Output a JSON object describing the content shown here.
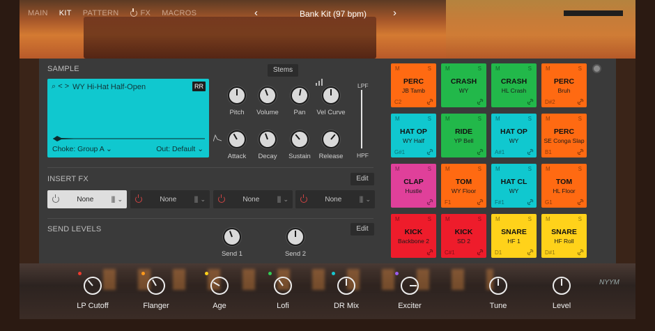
{
  "nav": {
    "items": [
      {
        "label": "MAIN",
        "active": false
      },
      {
        "label": "KIT",
        "active": true
      },
      {
        "label": "PATTERN",
        "active": false
      },
      {
        "label": "FX",
        "active": false
      },
      {
        "label": "MACROS",
        "active": false
      }
    ],
    "prev_icon": "‹",
    "next_icon": "›",
    "preset": "Bank Kit (97 bpm)"
  },
  "sample": {
    "section_label": "SAMPLE",
    "stems_label": "Stems",
    "nav_prefix": "⌕ < >",
    "name": "WY Hi-Hat Half-Open",
    "rr_label": "RR",
    "choke": "Choke: Group A",
    "output": "Out: Default",
    "display_color": "#10c8cf",
    "knobs": [
      {
        "label": "Pitch"
      },
      {
        "label": "Volume"
      },
      {
        "label": "Pan"
      },
      {
        "label": "Vel Curve"
      },
      {
        "label": "Attack"
      },
      {
        "label": "Decay"
      },
      {
        "label": "Sustain"
      },
      {
        "label": "Release"
      }
    ],
    "lpf_label": "LPF",
    "hpf_label": "HPF"
  },
  "insert_fx": {
    "section_label": "INSERT FX",
    "edit_label": "Edit",
    "slots": [
      {
        "name": "None",
        "active": true
      },
      {
        "name": "None",
        "active": false
      },
      {
        "name": "None",
        "active": false
      },
      {
        "name": "None",
        "active": false
      }
    ]
  },
  "send_levels": {
    "section_label": "SEND LEVELS",
    "edit_label": "Edit",
    "knobs": [
      {
        "label": "Send 1"
      },
      {
        "label": "Send 2"
      }
    ]
  },
  "pads": [
    {
      "title": "PERC",
      "sub": "JB Tamb",
      "note": "C2",
      "color": "#ff6a12"
    },
    {
      "title": "CRASH",
      "sub": "WY",
      "note": "",
      "color": "#22b84a"
    },
    {
      "title": "CRASH",
      "sub": "HL Crash",
      "note": "",
      "color": "#22b84a"
    },
    {
      "title": "PERC",
      "sub": "Bruh",
      "note": "D#2",
      "color": "#ff6a12"
    },
    {
      "title": "HAT OP",
      "sub": "WY Half",
      "note": "G#1",
      "color": "#10c8cf"
    },
    {
      "title": "RIDE",
      "sub": "YP Bell",
      "note": "",
      "color": "#22b84a"
    },
    {
      "title": "HAT OP",
      "sub": "WY",
      "note": "A#1",
      "color": "#10c8cf"
    },
    {
      "title": "PERC",
      "sub": "SE Conga Slap",
      "note": "B1",
      "color": "#ff6a12"
    },
    {
      "title": "CLAP",
      "sub": "Hustle",
      "note": "",
      "color": "#e0409a"
    },
    {
      "title": "TOM",
      "sub": "WY Floor",
      "note": "F1",
      "color": "#ff6a12"
    },
    {
      "title": "HAT CL",
      "sub": "WY",
      "note": "F#1",
      "color": "#10c8cf"
    },
    {
      "title": "TOM",
      "sub": "HL Floor",
      "note": "G1",
      "color": "#ff6a12"
    },
    {
      "title": "KICK",
      "sub": "Backbone 2",
      "note": "",
      "color": "#ee1c2b"
    },
    {
      "title": "KICK",
      "sub": "SD 2",
      "note": "C#1",
      "color": "#ee1c2b"
    },
    {
      "title": "SNARE",
      "sub": "HF 1",
      "note": "D1",
      "color": "#ffd21a"
    },
    {
      "title": "SNARE",
      "sub": "HF Roll",
      "note": "D#1",
      "color": "#ffd21a"
    }
  ],
  "pad_mute_label": "M",
  "pad_solo_label": "S",
  "macros": [
    {
      "label": "LP Cutoff",
      "dot": "#ee3b2e"
    },
    {
      "label": "Flanger",
      "dot": "#ff9a1c"
    },
    {
      "label": "Age",
      "dot": "#ffd21a"
    },
    {
      "label": "Lofi",
      "dot": "#33cc55"
    },
    {
      "label": "DR Mix",
      "dot": "#18c8d0"
    },
    {
      "label": "Exciter",
      "dot": "#9a5cf0"
    },
    {
      "label": "Tune",
      "dot": ""
    },
    {
      "label": "Level",
      "dot": ""
    }
  ],
  "logo_text": "NYYM"
}
